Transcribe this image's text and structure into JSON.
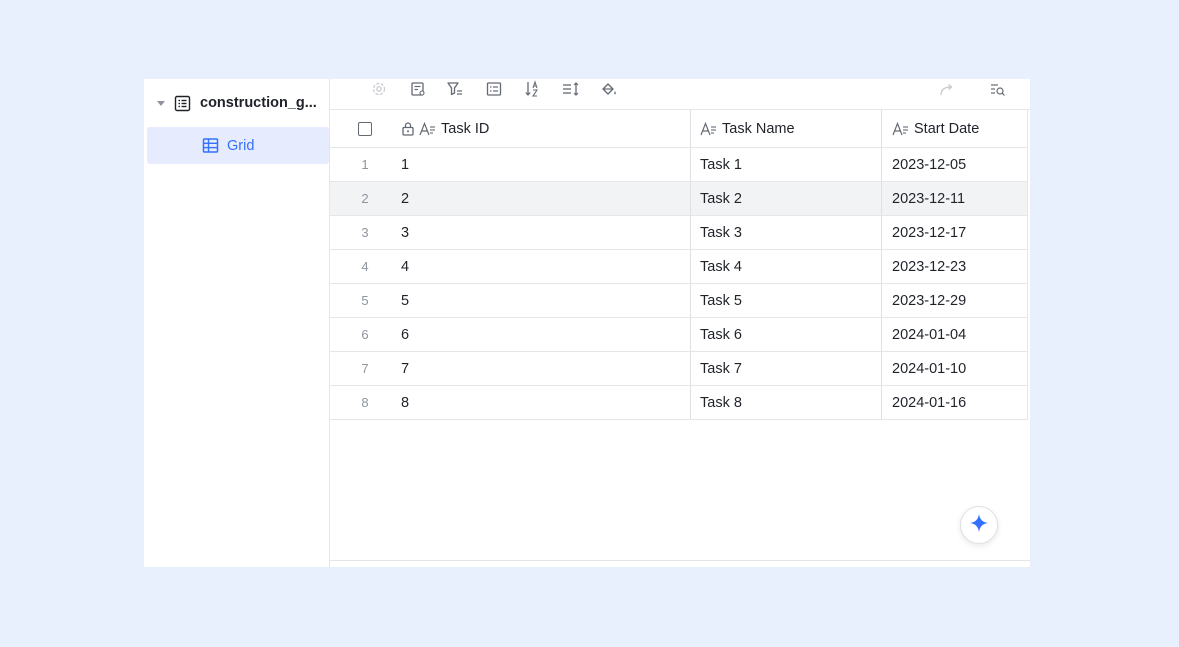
{
  "sidebar": {
    "root_label": "construction_g...",
    "child_label": "Grid"
  },
  "toolbar": {
    "icons": [
      "settings-icon",
      "form-icon",
      "filter-icon",
      "group-icon",
      "sort-icon",
      "row-height-icon",
      "fill-color-icon",
      "share-icon",
      "search-icon"
    ]
  },
  "grid": {
    "headers": {
      "task_id": "Task ID",
      "task_name": "Task Name",
      "start_date": "Start Date"
    },
    "rows": [
      {
        "num": "1",
        "id": "1",
        "name": "Task 1",
        "date": "2023-12-05"
      },
      {
        "num": "2",
        "id": "2",
        "name": "Task 2",
        "date": "2023-12-11"
      },
      {
        "num": "3",
        "id": "3",
        "name": "Task 3",
        "date": "2023-12-17"
      },
      {
        "num": "4",
        "id": "4",
        "name": "Task 4",
        "date": "2023-12-23"
      },
      {
        "num": "5",
        "id": "5",
        "name": "Task 5",
        "date": "2023-12-29"
      },
      {
        "num": "6",
        "id": "6",
        "name": "Task 6",
        "date": "2024-01-04"
      },
      {
        "num": "7",
        "id": "7",
        "name": "Task 7",
        "date": "2024-01-10"
      },
      {
        "num": "8",
        "id": "8",
        "name": "Task 8",
        "date": "2024-01-16"
      }
    ]
  },
  "colors": {
    "accent": "#3370ff",
    "background": "#e8effd",
    "selected_bg": "#e6ecfd",
    "hover_row": "#f2f3f5"
  }
}
